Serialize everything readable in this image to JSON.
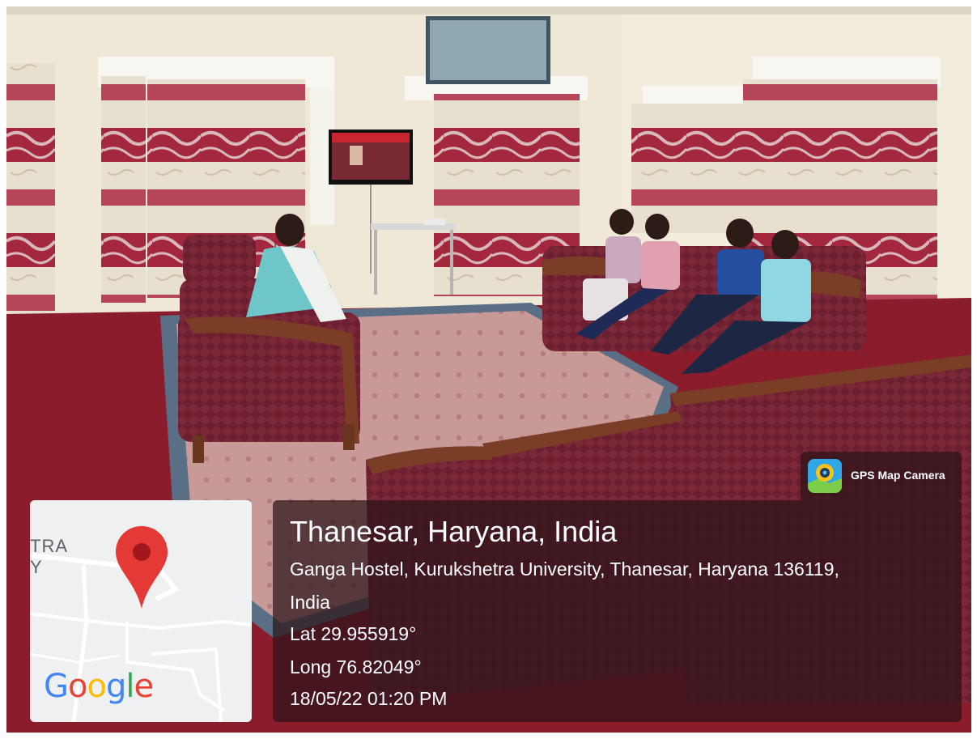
{
  "map": {
    "fragment_line1": "TRA",
    "fragment_line2": "Y",
    "logo": "Google",
    "logo_letters": [
      "G",
      "o",
      "o",
      "g",
      "l",
      "e"
    ],
    "logo_colors": [
      "#4285F4",
      "#EA4335",
      "#FBBC05",
      "#4285F4",
      "#34A853",
      "#EA4335"
    ],
    "pin_icon": "location-pin-icon",
    "pin_color": "#E53935"
  },
  "overlay": {
    "brand_label": "GPS Map Camera",
    "brand_icon": "gps-camera-app-icon",
    "title": "Thanesar, Haryana, India",
    "address_line1": "Ganga Hostel, Kurukshetra University, Thanesar, Haryana 136119,",
    "address_line2": "India",
    "latitude": "Lat 29.955919°",
    "longitude": "Long 76.82049°",
    "datetime": "18/05/22 01:20 PM"
  },
  "colors": {
    "panel_bg": "#2d1418",
    "carpet": "#8a1c2c",
    "sofa": "#6e2233",
    "wall": "#efe8d6"
  }
}
